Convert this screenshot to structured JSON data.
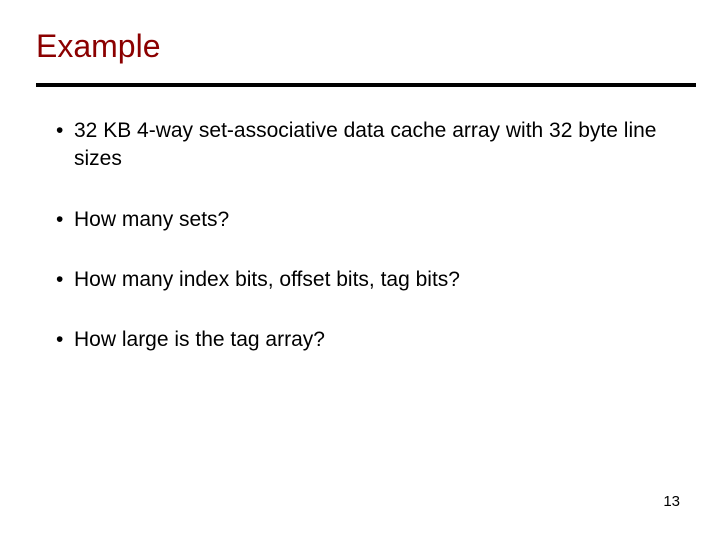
{
  "title": "Example",
  "bullets": [
    "32 KB 4-way set-associative data cache array with 32 byte line sizes",
    "How many sets?",
    "How many index bits, offset bits, tag bits?",
    "How large is the tag array?"
  ],
  "pageNumber": "13"
}
